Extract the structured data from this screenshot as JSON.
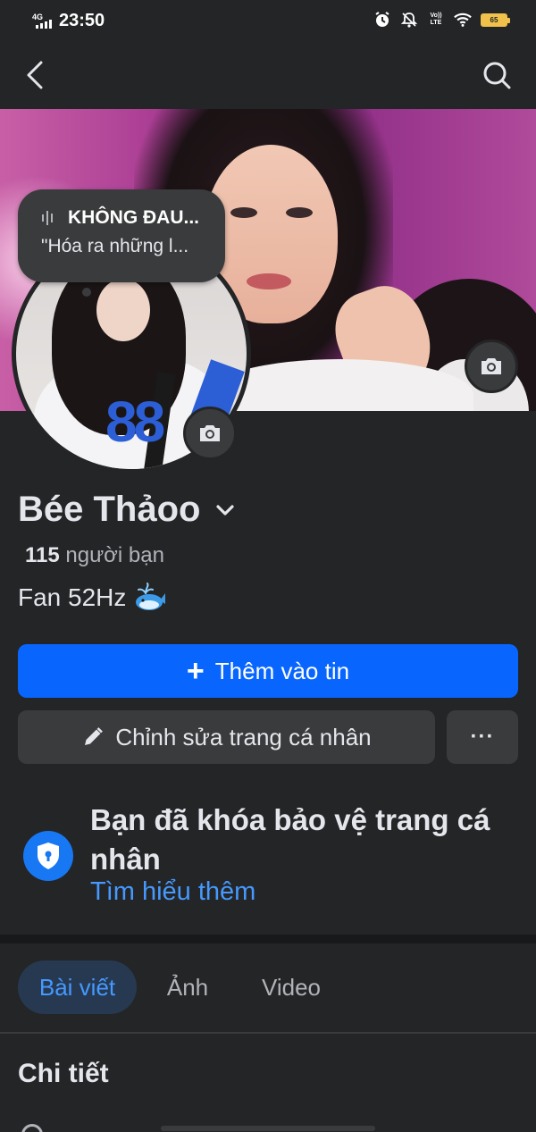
{
  "status_bar": {
    "network": "4G",
    "time": "23:50",
    "volte": "Vo)) LTE",
    "battery": "65"
  },
  "colors": {
    "background": "#242526",
    "primary_button": "#0866ff",
    "link": "#4599ff",
    "secondary_button": "#3a3b3c"
  },
  "nav": {
    "back_icon": "chevron-left-icon",
    "search_icon": "search-icon"
  },
  "note": {
    "title": "KHÔNG ĐAU...",
    "text": "\"Hóa ra những l..."
  },
  "profile": {
    "name": "Bée Thảoo",
    "friends_count": "115",
    "friends_label": "người bạn",
    "bio": "Fan 52Hz"
  },
  "actions": {
    "add_story": "Thêm vào tin",
    "edit_profile": "Chỉnh sửa trang cá nhân",
    "more": "···"
  },
  "lock_notice": {
    "title": "Bạn đã khóa bảo vệ trang cá nhân",
    "link": "Tìm hiểu thêm"
  },
  "tabs": [
    {
      "label": "Bài viết",
      "active": true
    },
    {
      "label": "Ảnh",
      "active": false
    },
    {
      "label": "Video",
      "active": false
    }
  ],
  "details": {
    "heading": "Chi tiết"
  }
}
